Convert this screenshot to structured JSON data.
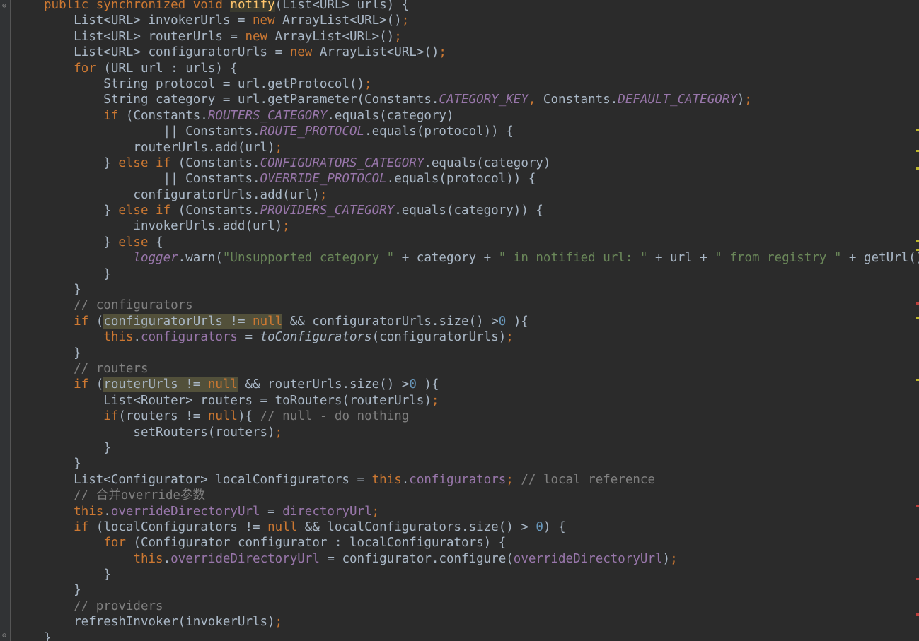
{
  "editor": {
    "colors": {
      "background": "#2b2b2b",
      "keyword": "#cc7832",
      "function": "#ffc66d",
      "constant": "#9876aa",
      "string": "#6a8759",
      "number": "#6897bb",
      "comment": "#808080",
      "text": "#a9b7c6",
      "highlight": "#52503a"
    },
    "lines": [
      [
        {
          "t": "public synchronized void ",
          "c": "kw"
        },
        {
          "t": "notify",
          "c": "fn-hl"
        },
        {
          "t": "(List<URL> urls) {",
          "c": ""
        }
      ],
      [
        {
          "t": "    List<URL> invokerUrls = ",
          "c": ""
        },
        {
          "t": "new ",
          "c": "kw"
        },
        {
          "t": "ArrayList<URL>()",
          "c": ""
        },
        {
          "t": ";",
          "c": "kw"
        }
      ],
      [
        {
          "t": "    List<URL> routerUrls = ",
          "c": ""
        },
        {
          "t": "new ",
          "c": "kw"
        },
        {
          "t": "ArrayList<URL>()",
          "c": ""
        },
        {
          "t": ";",
          "c": "kw"
        }
      ],
      [
        {
          "t": "    List<URL> configuratorUrls = ",
          "c": ""
        },
        {
          "t": "new ",
          "c": "kw"
        },
        {
          "t": "ArrayList<URL>()",
          "c": ""
        },
        {
          "t": ";",
          "c": "kw"
        }
      ],
      [
        {
          "t": "    ",
          "c": ""
        },
        {
          "t": "for ",
          "c": "kw"
        },
        {
          "t": "(URL url : urls) {",
          "c": ""
        }
      ],
      [
        {
          "t": "        String protocol = url.getProtocol()",
          "c": ""
        },
        {
          "t": ";",
          "c": "kw"
        }
      ],
      [
        {
          "t": "        String category = url.getParameter(Constants.",
          "c": ""
        },
        {
          "t": "CATEGORY_KEY",
          "c": "const"
        },
        {
          "t": ", ",
          "c": "kw"
        },
        {
          "t": "Constants.",
          "c": ""
        },
        {
          "t": "DEFAULT_CATEGORY",
          "c": "const"
        },
        {
          "t": ")",
          "c": ""
        },
        {
          "t": ";",
          "c": "kw"
        }
      ],
      [
        {
          "t": "        ",
          "c": ""
        },
        {
          "t": "if ",
          "c": "kw"
        },
        {
          "t": "(Constants.",
          "c": ""
        },
        {
          "t": "ROUTERS_CATEGORY",
          "c": "const"
        },
        {
          "t": ".equals(category)",
          "c": ""
        }
      ],
      [
        {
          "t": "                || Constants.",
          "c": ""
        },
        {
          "t": "ROUTE_PROTOCOL",
          "c": "const"
        },
        {
          "t": ".equals(protocol)) {",
          "c": ""
        }
      ],
      [
        {
          "t": "            routerUrls.add(url)",
          "c": ""
        },
        {
          "t": ";",
          "c": "kw"
        }
      ],
      [
        {
          "t": "        } ",
          "c": ""
        },
        {
          "t": "else if ",
          "c": "kw"
        },
        {
          "t": "(Constants.",
          "c": ""
        },
        {
          "t": "CONFIGURATORS_CATEGORY",
          "c": "const"
        },
        {
          "t": ".equals(category)",
          "c": ""
        }
      ],
      [
        {
          "t": "                || Constants.",
          "c": ""
        },
        {
          "t": "OVERRIDE_PROTOCOL",
          "c": "const"
        },
        {
          "t": ".equals(protocol)) {",
          "c": ""
        }
      ],
      [
        {
          "t": "            configuratorUrls.add(url)",
          "c": ""
        },
        {
          "t": ";",
          "c": "kw"
        }
      ],
      [
        {
          "t": "        } ",
          "c": ""
        },
        {
          "t": "else if ",
          "c": "kw"
        },
        {
          "t": "(Constants.",
          "c": ""
        },
        {
          "t": "PROVIDERS_CATEGORY",
          "c": "const"
        },
        {
          "t": ".equals(category)) {",
          "c": ""
        }
      ],
      [
        {
          "t": "            invokerUrls.add(url)",
          "c": ""
        },
        {
          "t": ";",
          "c": "kw"
        }
      ],
      [
        {
          "t": "        } ",
          "c": ""
        },
        {
          "t": "else ",
          "c": "kw"
        },
        {
          "t": "{",
          "c": ""
        }
      ],
      [
        {
          "t": "            ",
          "c": ""
        },
        {
          "t": "logger",
          "c": "const"
        },
        {
          "t": ".warn(",
          "c": ""
        },
        {
          "t": "\"Unsupported category \"",
          "c": "str"
        },
        {
          "t": " + category + ",
          "c": ""
        },
        {
          "t": "\" in notified url: \"",
          "c": "str"
        },
        {
          "t": " + url + ",
          "c": ""
        },
        {
          "t": "\" from registry \"",
          "c": "str"
        },
        {
          "t": " + getUrl()",
          "c": ""
        }
      ],
      [
        {
          "t": "        }",
          "c": ""
        }
      ],
      [
        {
          "t": "    }",
          "c": ""
        }
      ],
      [
        {
          "t": "    // configurators",
          "c": "com"
        }
      ],
      [
        {
          "t": "    ",
          "c": ""
        },
        {
          "t": "if ",
          "c": "kw"
        },
        {
          "t": "(",
          "c": ""
        },
        {
          "t": "configuratorUrls != ",
          "c": "hl"
        },
        {
          "t": "null",
          "c": "kw hl"
        },
        {
          "t": " && configuratorUrls.size() >",
          "c": ""
        },
        {
          "t": "0",
          "c": "num"
        },
        {
          "t": " ){",
          "c": ""
        }
      ],
      [
        {
          "t": "        ",
          "c": ""
        },
        {
          "t": "this",
          "c": "kw"
        },
        {
          "t": ".",
          "c": ""
        },
        {
          "t": "configurators",
          "c": "field"
        },
        {
          "t": " = ",
          "c": ""
        },
        {
          "t": "toConfigurators",
          "c": "static"
        },
        {
          "t": "(configuratorUrls)",
          "c": ""
        },
        {
          "t": ";",
          "c": "kw"
        }
      ],
      [
        {
          "t": "    }",
          "c": ""
        }
      ],
      [
        {
          "t": "    // routers",
          "c": "com"
        }
      ],
      [
        {
          "t": "    ",
          "c": ""
        },
        {
          "t": "if ",
          "c": "kw"
        },
        {
          "t": "(",
          "c": ""
        },
        {
          "t": "routerUrls != ",
          "c": "hl"
        },
        {
          "t": "null",
          "c": "kw hl"
        },
        {
          "t": " && routerUrls.size() >",
          "c": ""
        },
        {
          "t": "0",
          "c": "num"
        },
        {
          "t": " ){",
          "c": ""
        }
      ],
      [
        {
          "t": "        List<Router> routers = toRouters(routerUrls)",
          "c": ""
        },
        {
          "t": ";",
          "c": "kw"
        }
      ],
      [
        {
          "t": "        ",
          "c": ""
        },
        {
          "t": "if",
          "c": "kw"
        },
        {
          "t": "(routers != ",
          "c": ""
        },
        {
          "t": "null",
          "c": "kw"
        },
        {
          "t": "){ ",
          "c": ""
        },
        {
          "t": "// null - do nothing",
          "c": "com"
        }
      ],
      [
        {
          "t": "            setRouters(routers)",
          "c": ""
        },
        {
          "t": ";",
          "c": "kw"
        }
      ],
      [
        {
          "t": "        }",
          "c": ""
        }
      ],
      [
        {
          "t": "    }",
          "c": ""
        }
      ],
      [
        {
          "t": "    List<Configurator> localConfigurators = ",
          "c": ""
        },
        {
          "t": "this",
          "c": "kw"
        },
        {
          "t": ".",
          "c": ""
        },
        {
          "t": "configurators",
          "c": "field"
        },
        {
          "t": "; ",
          "c": "kw"
        },
        {
          "t": "// local reference",
          "c": "com"
        }
      ],
      [
        {
          "t": "    // 合并override参数",
          "c": "com"
        }
      ],
      [
        {
          "t": "    ",
          "c": ""
        },
        {
          "t": "this",
          "c": "kw"
        },
        {
          "t": ".",
          "c": ""
        },
        {
          "t": "overrideDirectoryUrl",
          "c": "field"
        },
        {
          "t": " = ",
          "c": ""
        },
        {
          "t": "directoryUrl",
          "c": "field"
        },
        {
          "t": ";",
          "c": "kw"
        }
      ],
      [
        {
          "t": "    ",
          "c": ""
        },
        {
          "t": "if ",
          "c": "kw"
        },
        {
          "t": "(localConfigurators != ",
          "c": ""
        },
        {
          "t": "null ",
          "c": "kw"
        },
        {
          "t": "&& localConfigurators.size() > ",
          "c": ""
        },
        {
          "t": "0",
          "c": "num"
        },
        {
          "t": ") {",
          "c": ""
        }
      ],
      [
        {
          "t": "        ",
          "c": ""
        },
        {
          "t": "for ",
          "c": "kw"
        },
        {
          "t": "(Configurator configurator : localConfigurators) {",
          "c": ""
        }
      ],
      [
        {
          "t": "            ",
          "c": ""
        },
        {
          "t": "this",
          "c": "kw"
        },
        {
          "t": ".",
          "c": ""
        },
        {
          "t": "overrideDirectoryUrl",
          "c": "field"
        },
        {
          "t": " = configurator.configure(",
          "c": ""
        },
        {
          "t": "overrideDirectoryUrl",
          "c": "field"
        },
        {
          "t": ")",
          "c": ""
        },
        {
          "t": ";",
          "c": "kw"
        }
      ],
      [
        {
          "t": "        }",
          "c": ""
        }
      ],
      [
        {
          "t": "    }",
          "c": ""
        }
      ],
      [
        {
          "t": "    // providers",
          "c": "com"
        }
      ],
      [
        {
          "t": "    refreshInvoker(invokerUrls)",
          "c": ""
        },
        {
          "t": ";",
          "c": "kw"
        }
      ],
      [
        {
          "t": "}",
          "c": ""
        }
      ]
    ]
  }
}
